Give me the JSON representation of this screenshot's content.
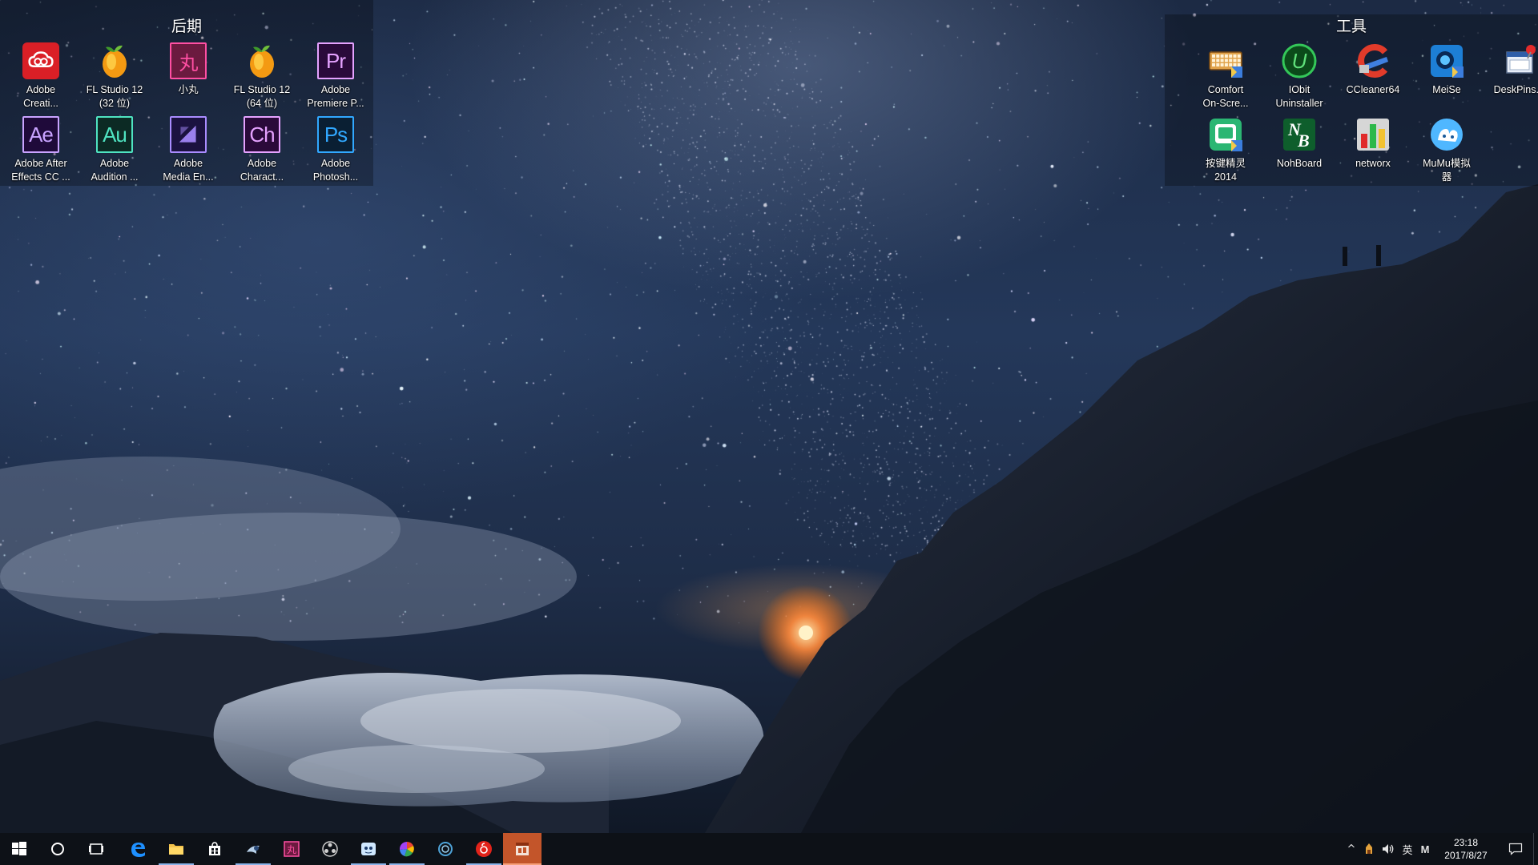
{
  "desktop": {
    "fences": [
      {
        "title": "后期",
        "icons": [
          {
            "label": "Adobe\nCreati...",
            "icon": "adobe-creative-cloud-icon",
            "bg": "#da1f26",
            "fg": "#ffffff",
            "glyph": "∞"
          },
          {
            "label": "FL Studio 12\n(32 位)",
            "icon": "fl-studio-icon"
          },
          {
            "label": "小丸",
            "icon": "xiaowan-icon",
            "bg": "#6b1a3f",
            "fg": "#ff4fa3",
            "glyph": "丸"
          },
          {
            "label": "FL Studio 12\n(64 位)",
            "icon": "fl-studio-icon"
          },
          {
            "label": "Adobe\nPremiere P...",
            "icon": "adobe-premiere-icon",
            "bg": "#2a0a3a",
            "fg": "#e5a2ff",
            "glyph": "Pr"
          },
          {
            "label": "Adobe After\nEffects CC ...",
            "icon": "adobe-after-effects-icon",
            "bg": "#1f0a3a",
            "fg": "#c9a3ff",
            "glyph": "Ae"
          },
          {
            "label": "Adobe\nAudition ...",
            "icon": "adobe-audition-icon",
            "bg": "#0c2a24",
            "fg": "#4fe3c1",
            "glyph": "Au"
          },
          {
            "label": "Adobe\nMedia En...",
            "icon": "adobe-media-encoder-icon",
            "bg": "#1b1240",
            "fg": "#a98cff",
            "glyph": "▦"
          },
          {
            "label": "Adobe\nCharact...",
            "icon": "adobe-character-animator-icon",
            "bg": "#2a0a3a",
            "fg": "#e5a2ff",
            "glyph": "Ch"
          },
          {
            "label": "Adobe\nPhotosh...",
            "icon": "adobe-photoshop-icon",
            "bg": "#0a1f33",
            "fg": "#31a8ff",
            "glyph": "Ps"
          }
        ]
      },
      {
        "title": "工具",
        "icons": [
          {
            "label": "Comfort\nOn-Scre...",
            "icon": "keyboard-icon"
          },
          {
            "label": "IObit\nUninstaller",
            "icon": "iobit-uninstaller-icon",
            "glyph": "U"
          },
          {
            "label": "CCleaner64",
            "icon": "ccleaner-icon"
          },
          {
            "label": "MeiSe",
            "icon": "meise-icon"
          },
          {
            "label": "DeskPins....",
            "icon": "deskpins-icon"
          },
          {
            "label": "按键精灵\n2014",
            "icon": "anjian-jingling-icon"
          },
          {
            "label": "NohBoard",
            "icon": "nohboard-icon",
            "glyph": "NB"
          },
          {
            "label": "networx",
            "icon": "networx-icon"
          },
          {
            "label": "MuMu模拟\n器",
            "icon": "mumu-emulator-icon"
          }
        ]
      }
    ]
  },
  "taskbar": {
    "apps": [
      {
        "name": "start-button",
        "icon": "windows-logo-icon"
      },
      {
        "name": "cortana-button",
        "icon": "search-circle-icon"
      },
      {
        "name": "task-view-button",
        "icon": "task-view-icon"
      },
      {
        "name": "taskbar-edge",
        "icon": "edge-icon"
      },
      {
        "name": "taskbar-file-explorer",
        "icon": "folder-icon",
        "active": true
      },
      {
        "name": "taskbar-store",
        "icon": "store-icon"
      },
      {
        "name": "taskbar-steam",
        "icon": "steam-icon",
        "active": true
      },
      {
        "name": "taskbar-xiaowan",
        "icon": "xiaowan-icon"
      },
      {
        "name": "taskbar-obs",
        "icon": "obs-icon"
      },
      {
        "name": "taskbar-qq-game",
        "icon": "qq-game-icon",
        "active": true
      },
      {
        "name": "taskbar-color-app",
        "icon": "color-wheel-icon",
        "active": true
      },
      {
        "name": "taskbar-steam-alt",
        "icon": "ring-icon"
      },
      {
        "name": "taskbar-netease-music",
        "icon": "netease-music-icon",
        "active": true
      },
      {
        "name": "taskbar-active-app",
        "icon": "app-window-icon",
        "focused": true
      }
    ],
    "tray": {
      "chevron": "^",
      "ime_lang": "英",
      "ime_mode": "M",
      "time": "23:18",
      "date": "2017/8/27"
    }
  },
  "colors": {
    "taskbar_bg": "#0d1117",
    "taskbar_active_underline": "#8ab4ea",
    "taskbar_focused": "#c3552a"
  }
}
